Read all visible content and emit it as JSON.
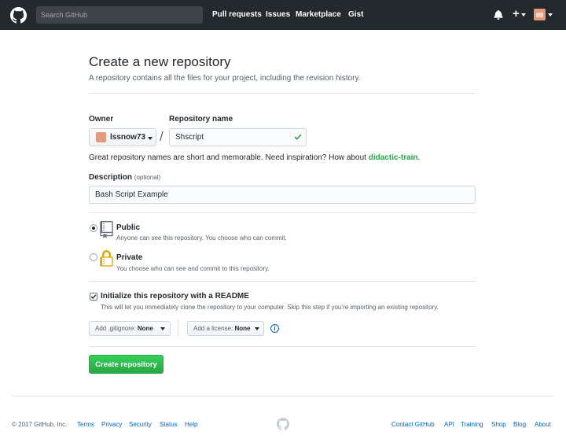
{
  "header": {
    "search_placeholder": "Search GitHub",
    "nav": [
      "Pull requests",
      "Issues",
      "Marketplace",
      "Gist"
    ]
  },
  "page": {
    "title": "Create a new repository",
    "subtitle": "A repository contains all the files for your project, including the revision history."
  },
  "form": {
    "owner_label": "Owner",
    "owner_value": "lssnow73",
    "repo_label": "Repository name",
    "repo_value": "Shscript",
    "hint_prefix": "Great repository names are short and memorable. Need inspiration? How about ",
    "hint_suggestion": "didactic-train",
    "hint_suffix": ".",
    "description_label": "Description",
    "description_optional": "(optional)",
    "description_value": "Bash Script Example",
    "public_title": "Public",
    "public_desc": "Anyone can see this repository. You choose who can commit.",
    "private_title": "Private",
    "private_desc": "You choose who can see and commit to this repository.",
    "visibility_selected": "Public",
    "readme_title": "Initialize this repository with a README",
    "readme_desc": "This will let you immediately clone the repository to your computer. Skip this step if you’re importing an existing repository.",
    "readme_checked": true,
    "gitignore_label": "Add .gitignore:",
    "gitignore_value": "None",
    "license_label": "Add a license:",
    "license_value": "None",
    "info_symbol": "i",
    "submit_label": "Create repository"
  },
  "footer": {
    "copyright": "© 2017 GitHub, Inc.",
    "left_links": [
      "Terms",
      "Privacy",
      "Security",
      "Status",
      "Help"
    ],
    "right_links": [
      "Contact GitHub",
      "API",
      "Training",
      "Shop",
      "Blog",
      "About"
    ]
  },
  "colors": {
    "header_bg": "#24292e",
    "accent_link": "#0366d6",
    "success": "#28a745"
  },
  "icons": [
    "github-logo-icon",
    "bell-icon",
    "plus-icon",
    "avatar",
    "checkmark-icon",
    "repo-icon",
    "lock-icon",
    "info-icon"
  ]
}
